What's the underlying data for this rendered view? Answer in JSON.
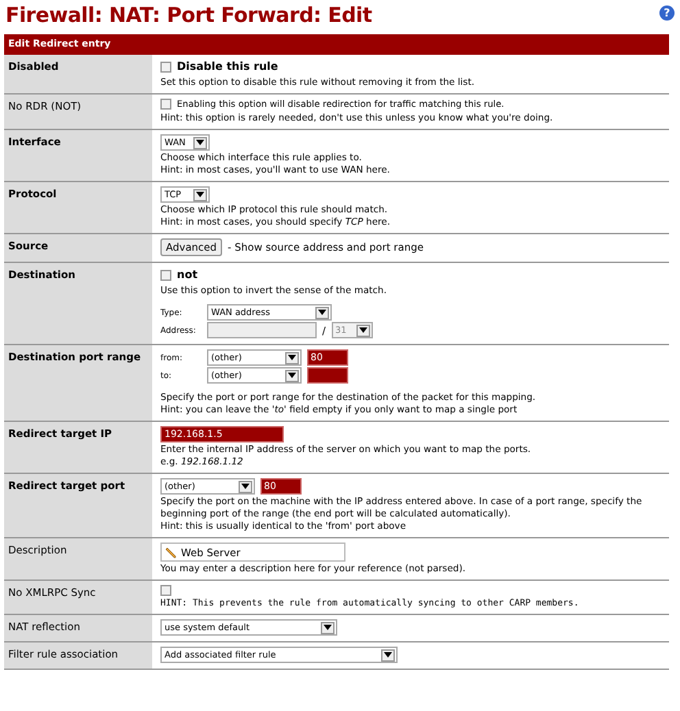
{
  "title": "Firewall: NAT: Port Forward: Edit",
  "help": "?",
  "section_header": "Edit Redirect entry",
  "rows": [
    {
      "label": "Disabled",
      "bold": true,
      "items": [
        {
          "kind": "line",
          "parts": [
            {
              "kind": "checkbox",
              "checked": false,
              "label": "Disable this rule",
              "bold": true
            }
          ]
        },
        {
          "kind": "note",
          "text": "Set this option to disable this rule without removing it from the list."
        }
      ]
    },
    {
      "label": "No RDR (NOT)",
      "bold": false,
      "items": [
        {
          "kind": "line",
          "parts": [
            {
              "kind": "checkbox",
              "checked": false,
              "label": "Enabling this option will disable redirection for traffic matching this rule.",
              "bold": false
            }
          ]
        },
        {
          "kind": "note",
          "text": "Hint: this option is rarely needed, don't use this unless you know what you're doing."
        }
      ]
    },
    {
      "label": "Interface",
      "bold": true,
      "items": [
        {
          "kind": "line",
          "parts": [
            {
              "kind": "select",
              "value": "WAN"
            }
          ]
        },
        {
          "kind": "note",
          "text": "Choose which interface this rule applies to."
        },
        {
          "kind": "note",
          "text": "Hint: in most cases, you'll want to use WAN here."
        }
      ]
    },
    {
      "label": "Protocol",
      "bold": true,
      "items": [
        {
          "kind": "line",
          "parts": [
            {
              "kind": "select",
              "value": "TCP"
            }
          ]
        },
        {
          "kind": "note",
          "text": "Choose which IP protocol this rule should match."
        },
        {
          "kind": "note",
          "text": "Hint: in most cases, you should specify *TCP* here."
        }
      ]
    },
    {
      "label": "Source",
      "bold": true,
      "items": [
        {
          "kind": "line",
          "parts": [
            {
              "kind": "button",
              "label": "Advanced"
            },
            {
              "kind": "text",
              "text": "- Show source address and port range"
            }
          ]
        }
      ]
    },
    {
      "label": "Destination",
      "bold": true,
      "items": [
        {
          "kind": "line",
          "parts": [
            {
              "kind": "checkbox",
              "checked": false,
              "label": "not",
              "bold": true
            }
          ]
        },
        {
          "kind": "note",
          "text": "Use this option to invert the sense of the match."
        },
        {
          "kind": "gap"
        },
        {
          "kind": "line",
          "parts": [
            {
              "kind": "label",
              "text": "Type:"
            },
            {
              "kind": "select",
              "value": "WAN address"
            }
          ]
        },
        {
          "kind": "line",
          "parts": [
            {
              "kind": "label",
              "text": "Address:"
            },
            {
              "kind": "input",
              "disabled": true
            },
            {
              "kind": "text",
              "text": "/"
            },
            {
              "kind": "select",
              "value": "31",
              "disabled": true
            }
          ]
        }
      ]
    },
    {
      "label": "Destination port range",
      "bold": true,
      "items": [
        {
          "kind": "line",
          "parts": [
            {
              "kind": "label",
              "text": "from:"
            },
            {
              "kind": "select",
              "value": "(other)"
            },
            {
              "kind": "input",
              "value": "80",
              "required": true
            }
          ]
        },
        {
          "kind": "line",
          "parts": [
            {
              "kind": "label",
              "text": "to:"
            },
            {
              "kind": "select",
              "value": "(other)"
            },
            {
              "kind": "input",
              "required": true
            }
          ]
        },
        {
          "kind": "gap"
        },
        {
          "kind": "note",
          "text": "Specify the port or port range for the destination of the packet for this mapping."
        },
        {
          "kind": "note",
          "text": "Hint: you can leave the *'to'* field empty if you only want to map a single port"
        }
      ]
    },
    {
      "label": "Redirect target IP",
      "bold": true,
      "items": [
        {
          "kind": "line",
          "parts": [
            {
              "kind": "input",
              "value": "192.168.1.5",
              "required": true
            }
          ]
        },
        {
          "kind": "note",
          "text": "Enter the internal IP address of the server on which you want to map the ports."
        },
        {
          "kind": "note",
          "text": "e.g. *192.168.1.12*"
        }
      ]
    },
    {
      "label": "Redirect target port",
      "bold": true,
      "items": [
        {
          "kind": "line",
          "parts": [
            {
              "kind": "select",
              "value": "(other)"
            },
            {
              "kind": "input",
              "value": "80",
              "required": true
            }
          ]
        },
        {
          "kind": "note",
          "text": "Specify the port on the machine with the IP address entered above. In case of a port range, specify the beginning port of the range (the end port will be calculated automatically)."
        },
        {
          "kind": "note",
          "text": "Hint: this is usually identical to the 'from' port above"
        }
      ]
    },
    {
      "label": "Description",
      "bold": false,
      "items": [
        {
          "kind": "line",
          "parts": [
            {
              "kind": "desc-input",
              "value": "Web Server"
            }
          ]
        },
        {
          "kind": "note",
          "text": "You may enter a description here for your reference (not parsed)."
        }
      ]
    },
    {
      "label": "No XMLRPC Sync",
      "bold": false,
      "items": [
        {
          "kind": "line",
          "parts": [
            {
              "kind": "checkbox",
              "checked": false
            }
          ]
        },
        {
          "kind": "note",
          "text": "HINT: This prevents the rule from automatically syncing to other CARP members.",
          "large": true
        }
      ]
    },
    {
      "label": "NAT reflection",
      "bold": false,
      "items": [
        {
          "kind": "line",
          "parts": [
            {
              "kind": "select",
              "value": "use system default"
            }
          ]
        }
      ]
    },
    {
      "label": "Filter rule association",
      "bold": false,
      "items": [
        {
          "kind": "line",
          "parts": [
            {
              "kind": "select",
              "value": "Add associated filter rule"
            }
          ]
        }
      ]
    }
  ]
}
